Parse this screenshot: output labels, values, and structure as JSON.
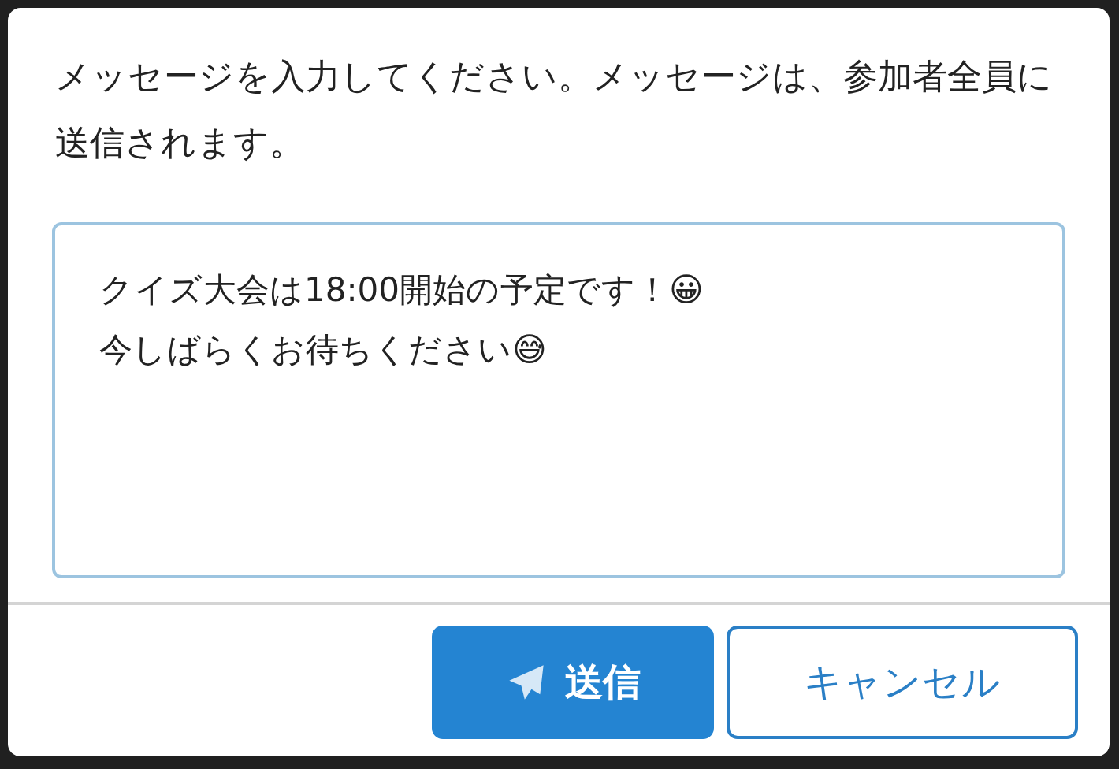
{
  "dialog": {
    "instruction": "メッセージを入力してください。メッセージは、参加者全員に送信されます。",
    "message": {
      "value": "クイズ大会は18:00開始の予定です！😀\n今しばらくお待ちください😅"
    },
    "buttons": [
      {
        "label": "送信",
        "kind": "primary"
      },
      {
        "label": "キャンセル",
        "kind": "secondary"
      }
    ]
  }
}
